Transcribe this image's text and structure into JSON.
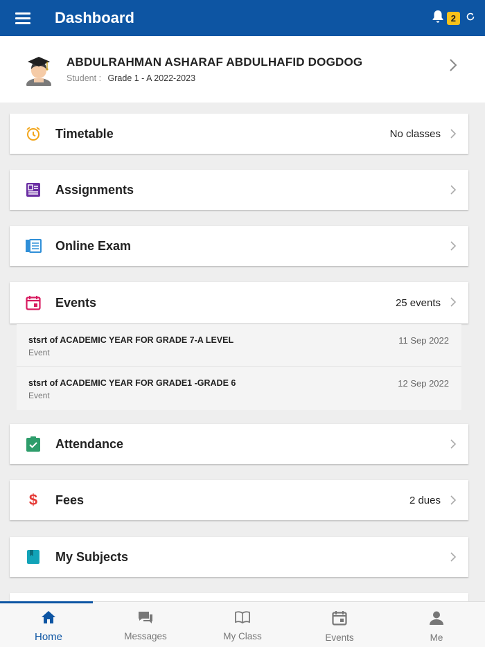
{
  "header": {
    "title": "Dashboard",
    "notification_count": "2"
  },
  "student": {
    "name": "ABDULRAHMAN ASHARAF ABDULHAFID DOGDOG",
    "role_label": "Student :",
    "class": "Grade 1 - A 2022-2023"
  },
  "cards": {
    "timetable": {
      "label": "Timetable",
      "meta": "No classes",
      "icon": "alarm-clock-icon",
      "color": "#f2a51a"
    },
    "assignments": {
      "label": "Assignments",
      "meta": "",
      "icon": "assignment-icon",
      "color": "#6b2fa3"
    },
    "online_exam": {
      "label": "Online Exam",
      "meta": "",
      "icon": "exam-icon",
      "color": "#2f8fd8"
    },
    "events": {
      "label": "Events",
      "meta": "25 events",
      "icon": "calendar-icon",
      "color": "#d81b60"
    },
    "attendance": {
      "label": "Attendance",
      "meta": "",
      "icon": "attendance-icon",
      "color": "#2e9d6b"
    },
    "fees": {
      "label": "Fees",
      "meta": "2 dues",
      "icon": "dollar-icon",
      "color": "#e53935"
    },
    "my_subjects": {
      "label": "My Subjects",
      "meta": "",
      "icon": "book-icon",
      "color": "#12a3b8"
    }
  },
  "events_list": [
    {
      "title": "stsrt of ACADEMIC YEAR FOR GRADE 7-A LEVEL",
      "type": "Event",
      "date": "11 Sep 2022"
    },
    {
      "title": "stsrt of ACADEMIC YEAR FOR GRADE1 -GRADE 6",
      "type": "Event",
      "date": "12 Sep 2022"
    }
  ],
  "bottom_nav": {
    "home": "Home",
    "messages": "Messages",
    "my_class": "My Class",
    "events": "Events",
    "me": "Me"
  },
  "colors": {
    "primary": "#0d55a3",
    "badge": "#f7c11a"
  }
}
